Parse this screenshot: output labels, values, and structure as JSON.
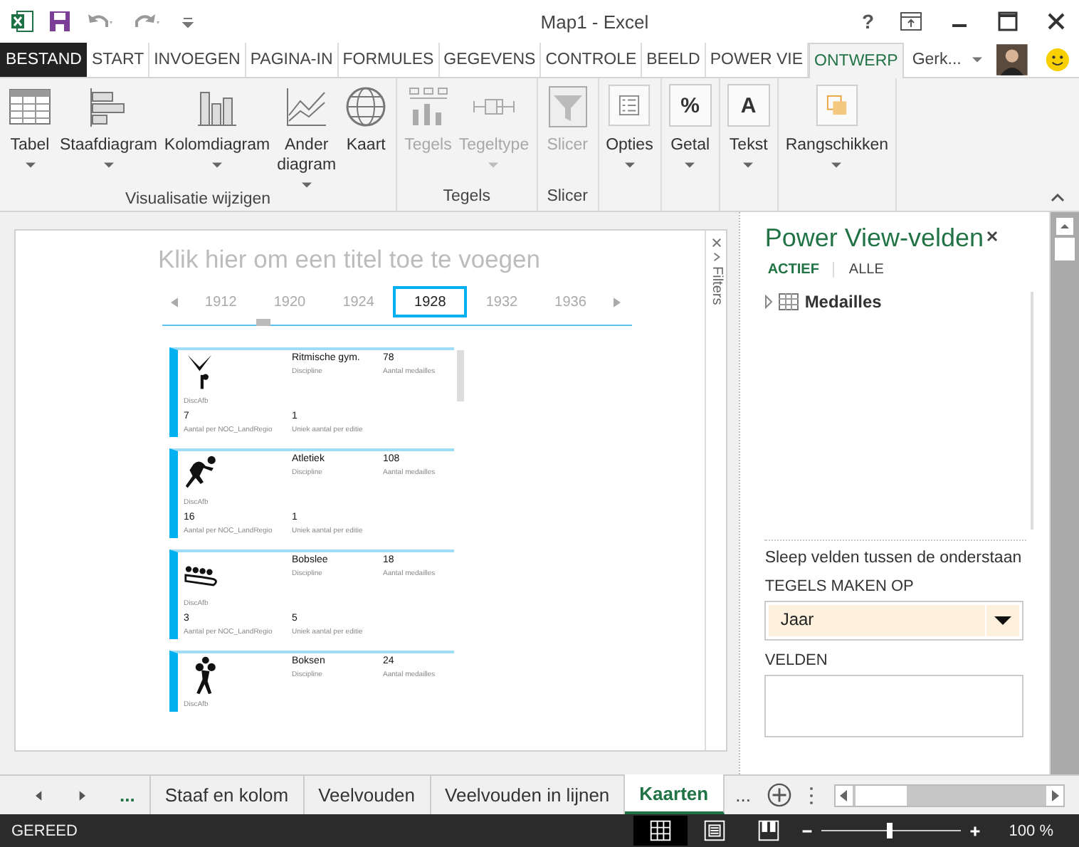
{
  "window": {
    "title": "Map1 - Excel",
    "help": "?"
  },
  "ribbon_tabs": [
    {
      "label": "BESTAND",
      "kind": "file",
      "selected": false
    },
    {
      "label": "START",
      "kind": "tab",
      "selected": false
    },
    {
      "label": "INVOEGEN",
      "kind": "tab",
      "selected": false
    },
    {
      "label": "PAGINA-IN",
      "kind": "tab",
      "selected": false
    },
    {
      "label": "FORMULES",
      "kind": "tab",
      "selected": false
    },
    {
      "label": "GEGEVENS",
      "kind": "tab",
      "selected": false
    },
    {
      "label": "CONTROLE",
      "kind": "tab",
      "selected": false
    },
    {
      "label": "BEELD",
      "kind": "tab",
      "selected": false
    },
    {
      "label": "POWER VIE",
      "kind": "tab",
      "selected": false
    },
    {
      "label": "ONTWERP",
      "kind": "tab",
      "selected": true
    }
  ],
  "user": {
    "name": "Gerk..."
  },
  "ribbon": {
    "groups": [
      {
        "label": "Visualisatie wijzigen",
        "buttons": [
          {
            "label": "Tabel",
            "disabled": false,
            "dropdown": true
          },
          {
            "label": "Staafdiagram",
            "disabled": false,
            "dropdown": true
          },
          {
            "label": "Kolomdiagram",
            "disabled": false,
            "dropdown": true
          },
          {
            "label": "Ander diagram",
            "disabled": false,
            "dropdown": true
          },
          {
            "label": "Kaart",
            "disabled": false,
            "dropdown": false
          }
        ]
      },
      {
        "label": "Tegels",
        "buttons": [
          {
            "label": "Tegels",
            "disabled": true,
            "dropdown": false
          },
          {
            "label": "Tegeltype",
            "disabled": true,
            "dropdown": true
          }
        ]
      },
      {
        "label": "Slicer",
        "buttons": [
          {
            "label": "Slicer",
            "disabled": true,
            "dropdown": false
          }
        ]
      },
      {
        "buttons": [
          {
            "label": "Opties",
            "disabled": false,
            "dropdown": true
          }
        ]
      },
      {
        "buttons": [
          {
            "label": "Getal",
            "glyph": "%",
            "disabled": false,
            "dropdown": true
          }
        ]
      },
      {
        "buttons": [
          {
            "label": "Tekst",
            "glyph": "A",
            "disabled": false,
            "dropdown": true
          }
        ]
      },
      {
        "buttons": [
          {
            "label": "Rangschikken",
            "disabled": false,
            "dropdown": true
          }
        ]
      }
    ]
  },
  "sheet": {
    "title_placeholder": "Klik hier om een titel toe te voegen",
    "filters_label": "Filters",
    "years": [
      {
        "label": "1912",
        "selected": false
      },
      {
        "label": "1920",
        "selected": false
      },
      {
        "label": "1924",
        "selected": false
      },
      {
        "label": "1928",
        "selected": true
      },
      {
        "label": "1932",
        "selected": false
      },
      {
        "label": "1936",
        "selected": false
      }
    ],
    "cards": [
      {
        "discipline": "Ritmische gym.",
        "discipline_label": "Discipline",
        "medals": "78",
        "medals_label": "Aantal medailles",
        "image_label": "DiscAfb",
        "noc_count": "7",
        "noc_label": "Aantal per NOC_LandRegio",
        "unique": "1",
        "unique_label": "Uniek aantal per editie"
      },
      {
        "discipline": "Atletiek",
        "discipline_label": "Discipline",
        "medals": "108",
        "medals_label": "Aantal medailles",
        "image_label": "DiscAfb",
        "noc_count": "16",
        "noc_label": "Aantal per NOC_LandRegio",
        "unique": "1",
        "unique_label": "Uniek aantal per editie"
      },
      {
        "discipline": "Bobslee",
        "discipline_label": "Discipline",
        "medals": "18",
        "medals_label": "Aantal medailles",
        "image_label": "DiscAfb",
        "noc_count": "3",
        "noc_label": "Aantal per NOC_LandRegio",
        "unique": "5",
        "unique_label": "Uniek aantal per editie"
      },
      {
        "discipline": "Boksen",
        "discipline_label": "Discipline",
        "medals": "24",
        "medals_label": "Aantal medailles",
        "image_label": "DiscAfb"
      }
    ]
  },
  "fields_pane": {
    "title": "Power View-velden",
    "tabs": [
      {
        "label": "ACTIEF",
        "selected": true
      },
      {
        "label": "ALLE",
        "selected": false
      }
    ],
    "tables": [
      {
        "name": "Medailles",
        "expanded": false
      }
    ],
    "hint": "Sleep velden tussen de onderstaan",
    "tiles_label": "TEGELS MAKEN OP",
    "tiles_value": "Jaar",
    "fields_label": "VELDEN"
  },
  "sheet_tabs": {
    "more_left": "...",
    "more_right": "...",
    "items": [
      {
        "label": "Staaf en kolom",
        "selected": false
      },
      {
        "label": "Veelvouden",
        "selected": false
      },
      {
        "label": "Veelvouden in lijnen",
        "selected": false
      },
      {
        "label": "Kaarten",
        "selected": true
      }
    ]
  },
  "status_bar": {
    "text": "GEREED",
    "zoom": {
      "level": 0.5,
      "reading": "100 %"
    }
  }
}
